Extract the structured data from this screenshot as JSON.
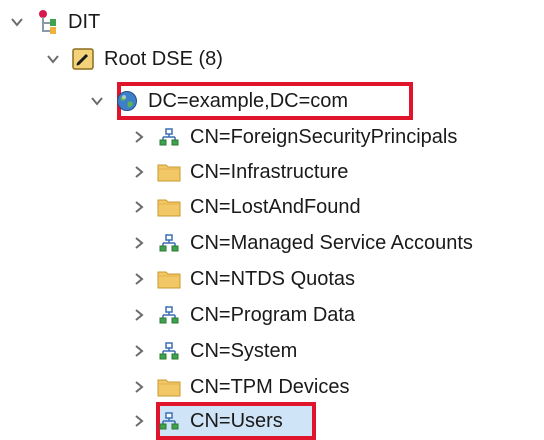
{
  "tree": {
    "root": {
      "label": "DIT",
      "icon": "dit-tree-icon",
      "expanded": true
    },
    "rootdse": {
      "label": "Root DSE (8)",
      "icon": "root-dse-icon",
      "expanded": true
    },
    "domain": {
      "label": "DC=example,DC=com",
      "icon": "globe-icon",
      "expanded": true,
      "highlighted": true
    },
    "children": [
      {
        "label": "CN=ForeignSecurityPrincipals",
        "icon": "org-unit-icon",
        "expanded": false
      },
      {
        "label": "CN=Infrastructure",
        "icon": "folder-icon",
        "expanded": false
      },
      {
        "label": "CN=LostAndFound",
        "icon": "folder-icon",
        "expanded": false
      },
      {
        "label": "CN=Managed Service Accounts",
        "icon": "org-unit-icon",
        "expanded": false
      },
      {
        "label": "CN=NTDS Quotas",
        "icon": "folder-icon",
        "expanded": false
      },
      {
        "label": "CN=Program Data",
        "icon": "org-unit-icon",
        "expanded": false
      },
      {
        "label": "CN=System",
        "icon": "org-unit-icon",
        "expanded": false
      },
      {
        "label": "CN=TPM Devices",
        "icon": "folder-icon",
        "expanded": false
      },
      {
        "label": "CN=Users",
        "icon": "org-unit-icon",
        "expanded": false,
        "selected": true,
        "highlighted": true
      }
    ]
  },
  "colors": {
    "highlight_border": "#e0142a",
    "selection_fill": "#cfe4f7",
    "chevron": "#6b6b6b",
    "folder": "#f2c766"
  }
}
